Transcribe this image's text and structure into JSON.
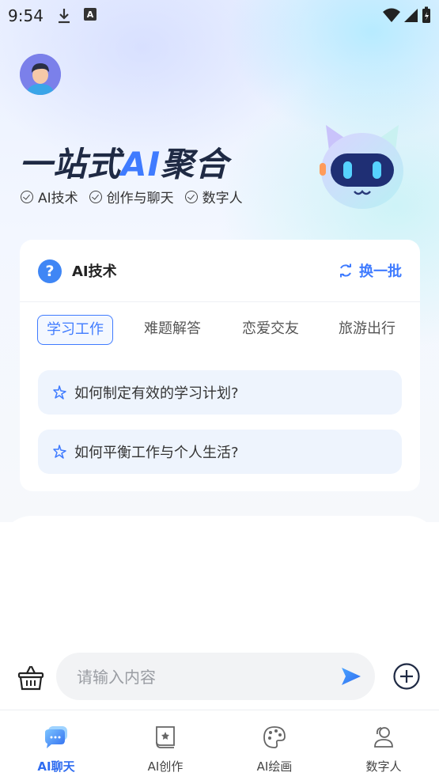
{
  "status_bar": {
    "time": "9:54",
    "download_icon": "download-icon",
    "notif_icon_letter": "A"
  },
  "hero": {
    "title_prefix": "一站式",
    "title_ai": "AI",
    "title_suffix": "聚合",
    "tags": [
      "AI技术",
      "创作与聊天",
      "数字人"
    ]
  },
  "card": {
    "title": "AI技术",
    "refresh_label": "换一批",
    "tabs": [
      {
        "label": "学习工作",
        "active": true
      },
      {
        "label": "难题解答",
        "active": false
      },
      {
        "label": "恋爱交友",
        "active": false
      },
      {
        "label": "旅游出行",
        "active": false
      }
    ],
    "questions": [
      "如何制定有效的学习计划?",
      "如何平衡工作与个人生活?"
    ]
  },
  "input": {
    "placeholder": "请输入内容"
  },
  "tabbar": [
    {
      "label": "AI聊天",
      "icon": "chat-bubble-icon",
      "active": true
    },
    {
      "label": "AI创作",
      "icon": "book-star-icon",
      "active": false
    },
    {
      "label": "AI绘画",
      "icon": "palette-icon",
      "active": false
    },
    {
      "label": "数字人",
      "icon": "person-icon",
      "active": false
    }
  ],
  "colors": {
    "accent": "#3f7bff",
    "title_dark": "#1f2a44",
    "question_bg": "#eef4fd"
  }
}
